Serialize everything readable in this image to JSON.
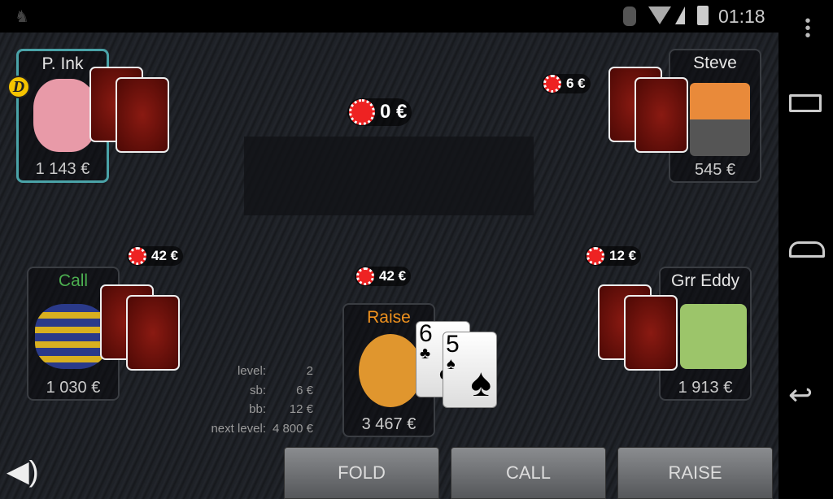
{
  "status_bar": {
    "time": "01:18",
    "icons": [
      "llama-icon",
      "bluetooth-icon",
      "wifi-icon",
      "signal-icon",
      "battery-icon"
    ]
  },
  "nav_bar": {
    "icons": [
      "overflow-menu-icon",
      "recent-apps-icon",
      "home-icon",
      "back-icon"
    ]
  },
  "pot": {
    "amount": "0 €"
  },
  "players": [
    {
      "name": "P. Ink",
      "stack": "1 143 €",
      "dealer": "D",
      "active": true
    },
    {
      "name": "Steve",
      "stack": "545 €",
      "bet": "6 €"
    },
    {
      "name": "Call",
      "stack": "1 030 €",
      "bet": "42 €",
      "action_color": "#4caf50"
    },
    {
      "name": "Raise",
      "stack": "3 467 €",
      "bet": "42 €",
      "action_color": "#f0921e",
      "cards": [
        {
          "rank": "6",
          "suit": "♣"
        },
        {
          "rank": "5",
          "suit": "♠"
        }
      ]
    },
    {
      "name": "Grr Eddy",
      "stack": "1 913 €",
      "bet": "12 €"
    }
  ],
  "info": {
    "level_label": "level:",
    "level": "2",
    "sb_label": "sb:",
    "sb": "6 €",
    "bb_label": "bb:",
    "bb": "12 €",
    "next_label": "next level:",
    "next": "4 800 €"
  },
  "buttons": {
    "fold": "FOLD",
    "call": "CALL",
    "raise": "RAISE"
  },
  "colors": {
    "active_border": "#4aa3a8",
    "chip": "#e22222"
  }
}
